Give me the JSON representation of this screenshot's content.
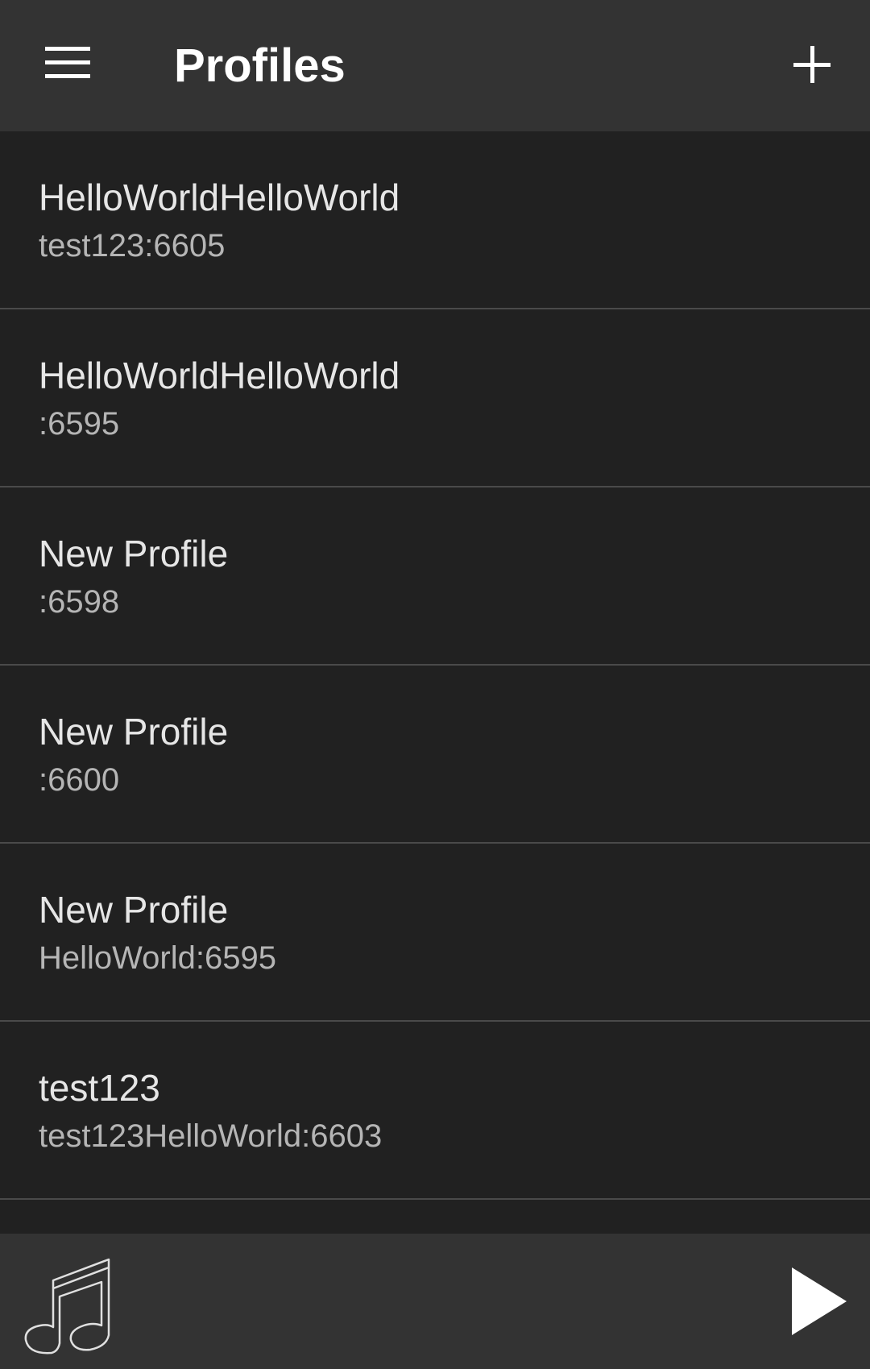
{
  "header": {
    "title": "Profiles",
    "menu_icon": "hamburger-menu-icon",
    "add_icon": "plus-icon"
  },
  "profiles": [
    {
      "name": "HelloWorldHelloWorld",
      "address": "test123:6605"
    },
    {
      "name": "HelloWorldHelloWorld",
      "address": ":6595"
    },
    {
      "name": "New Profile",
      "address": ":6598"
    },
    {
      "name": "New Profile",
      "address": ":6600"
    },
    {
      "name": "New Profile",
      "address": "HelloWorld:6595"
    },
    {
      "name": "test123",
      "address": "test123HelloWorld:6603"
    }
  ],
  "footer": {
    "music_icon": "music-note-icon",
    "play_icon": "play-icon"
  },
  "colors": {
    "background": "#212121",
    "bar": "#333333",
    "divider": "#4a4a4a",
    "primary_text": "#e6e6e6",
    "secondary_text": "#b5b5b5"
  }
}
